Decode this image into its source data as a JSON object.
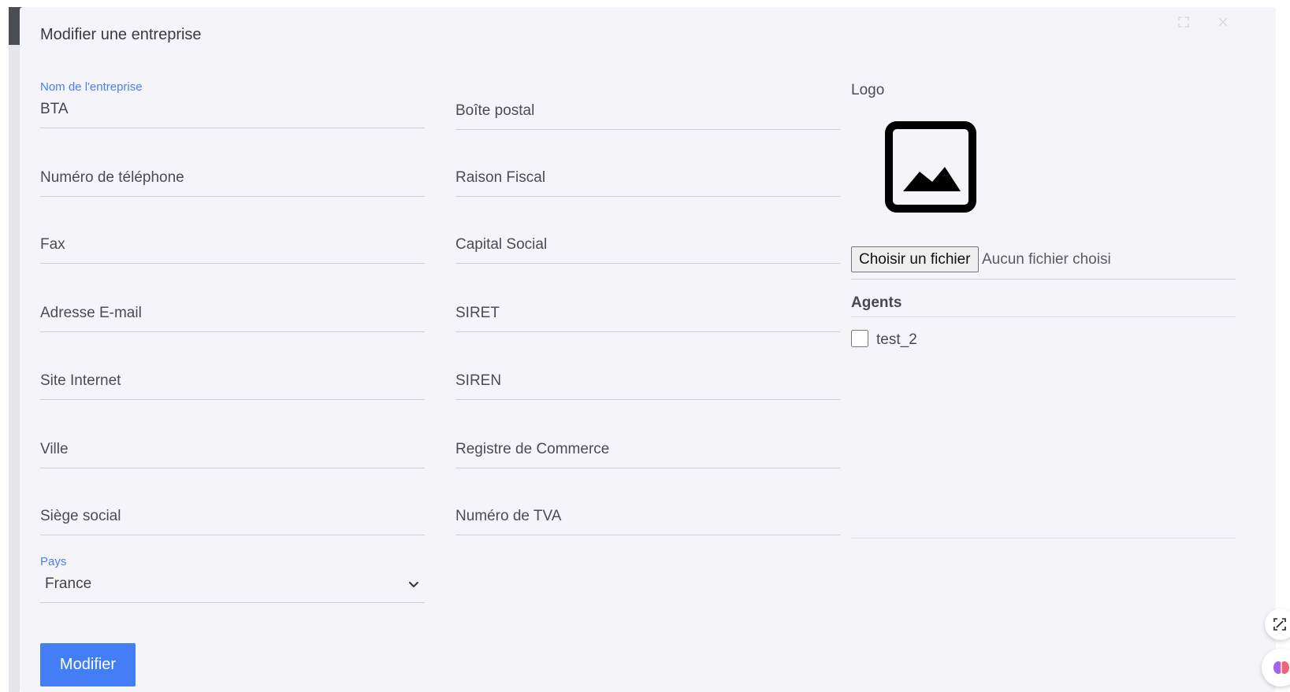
{
  "modal": {
    "title": "Modifier une entreprise"
  },
  "form": {
    "left_fields": [
      {
        "label": "Nom de l'entreprise",
        "value": "BTA"
      },
      {
        "placeholder": "Numéro de téléphone"
      },
      {
        "placeholder": "Fax"
      },
      {
        "placeholder": "Adresse E-mail"
      },
      {
        "placeholder": "Site Internet"
      },
      {
        "placeholder": "Ville"
      },
      {
        "placeholder": "Siège social"
      }
    ],
    "right_fields": [
      {
        "placeholder": "Boîte postal"
      },
      {
        "placeholder": "Raison Fiscal"
      },
      {
        "placeholder": "Capital Social"
      },
      {
        "placeholder": "SIRET"
      },
      {
        "placeholder": "SIREN"
      },
      {
        "placeholder": "Registre de Commerce"
      },
      {
        "placeholder": "Numéro de TVA"
      }
    ],
    "country": {
      "label": "Pays",
      "selected": "France"
    }
  },
  "logo": {
    "label": "Logo",
    "file_button": "Choisir un fichier",
    "file_status": "Aucun fichier choisi"
  },
  "agents": {
    "heading": "Agents",
    "items": [
      {
        "label": "test_2",
        "checked": false
      }
    ]
  },
  "actions": {
    "submit_label": "Modifier"
  },
  "colors": {
    "accent": "#437ef7",
    "label_accent": "#4d7cf6",
    "modal_background": "#f5f5f9",
    "divider": "#cfd0d6"
  },
  "icons": {
    "logo_placeholder": "image-placeholder-icon",
    "select_arrow": "chevron-down-icon",
    "floating_1": "screenshot-icon",
    "floating_2": "brain-icon"
  }
}
